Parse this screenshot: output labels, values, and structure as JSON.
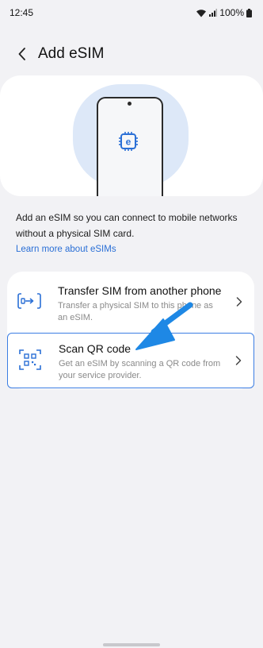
{
  "status_bar": {
    "time": "12:45",
    "battery": "100%",
    "icons": [
      "wifi-icon",
      "signal-icon",
      "battery-icon"
    ]
  },
  "header": {
    "title": "Add eSIM",
    "back_icon": "back-arrow-icon"
  },
  "hero": {
    "illustration": "phone-with-esim-chip",
    "chip_letter": "e"
  },
  "description": "Add an eSIM so you can connect to mobile networks without a physical SIM card.",
  "learn_more": "Learn more about eSIMs",
  "options": [
    {
      "title": "Transfer SIM from another phone",
      "subtitle": "Transfer a physical SIM to this phone as an eSIM.",
      "icon": "transfer-sim-icon"
    },
    {
      "title": "Scan QR code",
      "subtitle": "Get an eSIM by scanning a QR code from your service provider.",
      "icon": "qr-scan-icon",
      "highlighted": true
    }
  ],
  "colors": {
    "accent": "#3b7de3",
    "link": "#2a6fd6",
    "background": "#f2f2f5",
    "annotation_arrow": "#1e88e5"
  }
}
